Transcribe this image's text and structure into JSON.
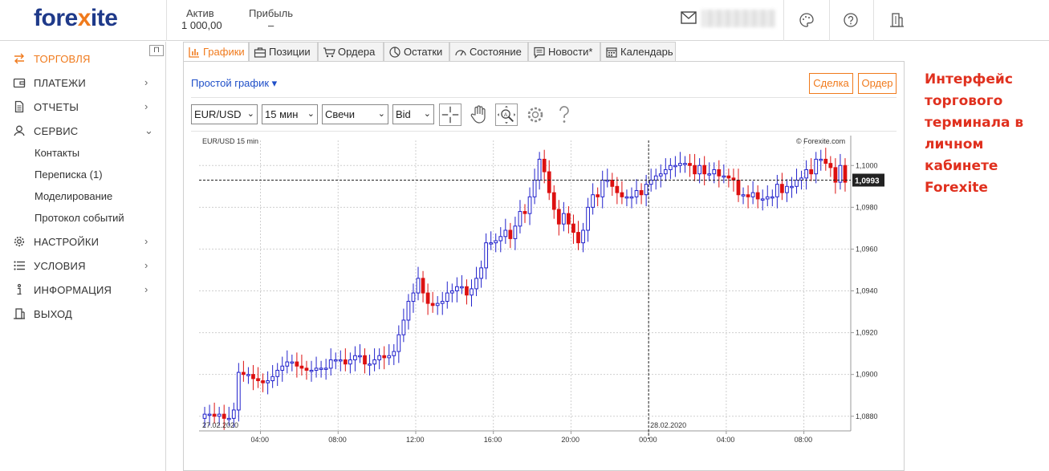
{
  "header": {
    "logo_prefix": "fore",
    "logo_x": "x",
    "logo_suffix": "ite",
    "aktiv_label": "Актив",
    "aktiv_value": "1 000,00",
    "profit_label": "Прибыль",
    "profit_value": "–",
    "icons": [
      "mail-icon",
      "palette-icon",
      "help-icon",
      "building-icon"
    ]
  },
  "sidebar": {
    "pin_label": "⊓",
    "items": [
      {
        "label": "ТОРГОВЛЯ",
        "icon": "transfer-arrows-icon",
        "active": true,
        "chevron": ""
      },
      {
        "label": "ПЛАТЕЖИ",
        "icon": "wallet-icon",
        "chevron": "›"
      },
      {
        "label": "ОТЧЕТЫ",
        "icon": "document-icon",
        "chevron": "›"
      },
      {
        "label": "СЕРВИС",
        "icon": "support-icon",
        "chevron": "⌄"
      },
      {
        "label": "НАСТРОЙКИ",
        "icon": "gear-icon",
        "chevron": "›"
      },
      {
        "label": "УСЛОВИЯ",
        "icon": "list-icon",
        "chevron": "›"
      },
      {
        "label": "ИНФОРМАЦИЯ",
        "icon": "info-icon",
        "chevron": "›"
      },
      {
        "label": "ВЫХОД",
        "icon": "exit-icon",
        "chevron": ""
      }
    ],
    "sub_items": [
      "Контакты",
      "Переписка (1)",
      "Моделирование",
      "Протокол событий"
    ]
  },
  "tabs": [
    {
      "label": "Графики",
      "active": true
    },
    {
      "label": "Позиции"
    },
    {
      "label": "Ордера"
    },
    {
      "label": "Остатки"
    },
    {
      "label": "Состояние"
    },
    {
      "label": "Новости*"
    },
    {
      "label": "Календарь"
    }
  ],
  "panel": {
    "simple_chart_link": "Простой график ▾",
    "deal_button": "Сделка",
    "order_button": "Ордер",
    "symbol": "EUR/USD",
    "timeframe": "15 мин",
    "chart_type": "Свечи",
    "price_side": "Bid"
  },
  "annotation": "Интерфейс торгового терминала в личном кабинете Forexite",
  "colors": {
    "accent": "#f07a1c",
    "bull": "#2222cc",
    "bear": "#dd1111",
    "link": "#1f4fc8"
  },
  "chart_data": {
    "type": "candlestick",
    "title_left": "EUR/USD 15 min",
    "title_right": "© Forexite.com",
    "y_ticks": [
      "1,1000",
      "1,0980",
      "1,0960",
      "1,0940",
      "1,0920",
      "1,0900",
      "1,0880"
    ],
    "y_tick_values": [
      1.1,
      1.098,
      1.096,
      1.094,
      1.092,
      1.09,
      1.088
    ],
    "ylim": [
      1.0873,
      1.1012
    ],
    "x_ticks": [
      "04:00",
      "08:00",
      "12:00",
      "16:00",
      "20:00",
      "00:00",
      "04:00",
      "08:00"
    ],
    "date_labels": [
      "27.02.2020",
      "28.02.2020"
    ],
    "current_price": "1,0993",
    "current_value": 1.0993,
    "closes": [
      1.0881,
      1.0881,
      1.088,
      1.0881,
      1.0879,
      1.0879,
      1.0883,
      1.0901,
      1.09,
      1.09,
      1.0898,
      1.0897,
      1.0896,
      1.0897,
      1.0899,
      1.0902,
      1.0904,
      1.0906,
      1.0906,
      1.0904,
      1.0903,
      1.0902,
      1.0902,
      1.0903,
      1.0903,
      1.0903,
      1.0907,
      1.0907,
      1.0907,
      1.0905,
      1.0907,
      1.0909,
      1.0909,
      1.0905,
      1.0905,
      1.0907,
      1.0909,
      1.0908,
      1.0909,
      1.0911,
      1.0919,
      1.0926,
      1.0935,
      1.0939,
      1.0946,
      1.0939,
      1.0934,
      1.0933,
      1.0934,
      1.0935,
      1.0939,
      1.094,
      1.0942,
      1.0942,
      1.0938,
      1.0941,
      1.0946,
      1.0951,
      1.0963,
      1.0963,
      1.0964,
      1.0966,
      1.0969,
      1.0965,
      1.0971,
      1.0978,
      1.0977,
      1.0985,
      1.0993,
      1.1003,
      1.0997,
      1.0987,
      1.0979,
      1.0972,
      1.0977,
      1.0972,
      1.0968,
      1.0963,
      1.0969,
      1.098,
      1.0986,
      1.0985,
      1.0993,
      1.0993,
      1.099,
      1.0987,
      1.0985,
      1.0985,
      1.0985,
      1.0988,
      1.0986,
      1.0991,
      1.0993,
      1.0995,
      1.0996,
      1.0998,
      1.1,
      1.1,
      1.1001,
      1.1001,
      1.1,
      1.0996,
      1.1,
      1.0996,
      1.0996,
      1.0998,
      1.0995,
      1.0995,
      1.0994,
      1.0993,
      1.0986,
      1.0986,
      1.0985,
      1.0987,
      1.0984,
      1.0984,
      1.0985,
      1.0985,
      1.0991,
      1.0987,
      1.099,
      1.099,
      1.0993,
      1.0994,
      1.0998,
      1.0996,
      1.1003,
      1.1003,
      1.1001,
      1.0999,
      1.0992,
      1.1,
      1.0992
    ]
  }
}
